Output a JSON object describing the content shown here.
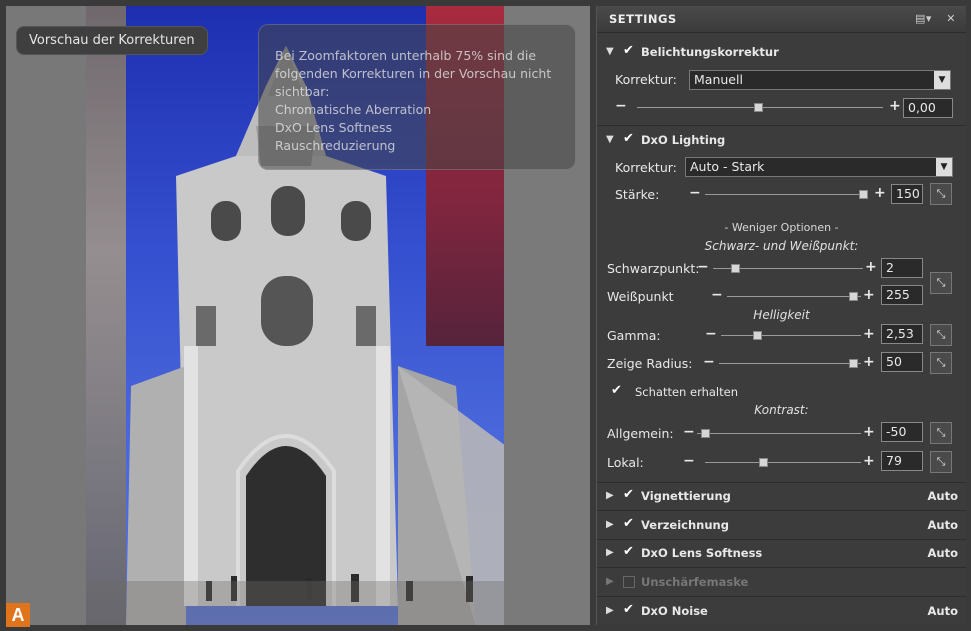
{
  "preview": {
    "label": "Vorschau der Korrekturen",
    "info_lines": [
      "Bei Zoomfaktoren unterhalb 75% sind die",
      "folgenden Korrekturen in der Vorschau nicht",
      "sichtbar:",
      "Chromatische Aberration",
      "DxO Lens Softness",
      "Rauschreduzierung"
    ],
    "badge": "A"
  },
  "panel": {
    "title": "SETTINGS",
    "header_icons": [
      "menu-icon",
      "close-icon"
    ],
    "belichtung": {
      "title": "Belichtungskorrektur",
      "korrektur_label": "Korrektur:",
      "korrektur_value": "Manuell",
      "value": "0,00",
      "slider_level": 0.5
    },
    "lighting": {
      "title": "DxO Lighting",
      "korrektur_label": "Korrektur:",
      "korrektur_value": "Auto - Stark",
      "staerke_label": "Stärke:",
      "staerke_value": "150",
      "staerke_level": 1.0,
      "weniger_optionen": "- Weniger Optionen -",
      "bw_heading": "Schwarz- und Weißpunkt:",
      "schwarzpunkt_label": "Schwarzpunkt:",
      "schwarzpunkt_value": "2",
      "weisspunkt_label": "Weißpunkt",
      "weisspunkt_value": "255",
      "helligkeit_heading": "Helligkeit",
      "gamma_label": "Gamma:",
      "gamma_value": "2,53",
      "zeige_radius_label": "Zeige Radius:",
      "zeige_radius_value": "50",
      "schatten_label": "Schatten erhalten",
      "kontrast_heading": "Kontrast:",
      "allgemein_label": "Allgemein:",
      "allgemein_value": "-50",
      "lokal_label": "Lokal:",
      "lokal_value": "79"
    },
    "collapsed": [
      {
        "title": "Vignettierung",
        "status": "Auto",
        "checked": true
      },
      {
        "title": "Verzeichnung",
        "status": "Auto",
        "checked": true
      },
      {
        "title": "DxO Lens Softness",
        "status": "Auto",
        "checked": true
      },
      {
        "title": "Unschärfemaske",
        "status": "",
        "checked": false
      },
      {
        "title": "DxO Noise",
        "status": "Auto",
        "checked": true
      }
    ]
  }
}
